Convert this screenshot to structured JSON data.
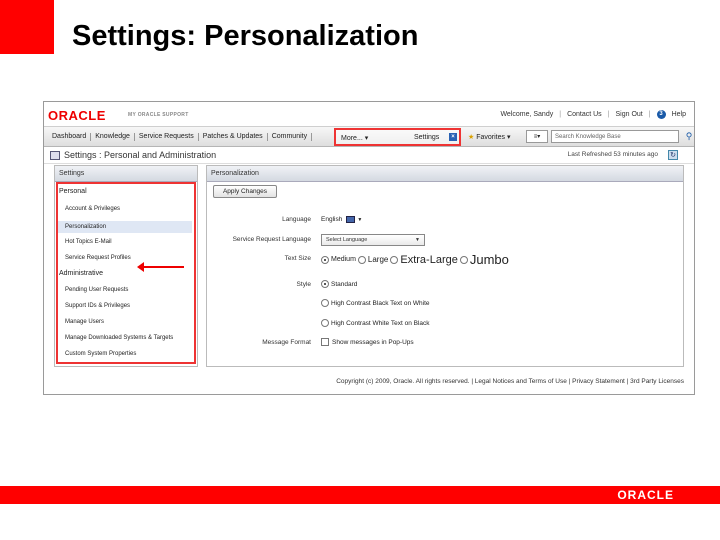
{
  "slide": {
    "title": "Settings: Personalization",
    "footer_logo": "ORACLE"
  },
  "app": {
    "logo": "ORACLE",
    "product": "MY ORACLE SUPPORT",
    "top_links": [
      "Welcome, Sandy",
      "Contact Us",
      "Sign Out",
      "Help"
    ],
    "help_number": "3"
  },
  "nav": {
    "tabs": [
      "Dashboard",
      "Knowledge",
      "Service Requests",
      "Patches & Updates",
      "Community"
    ],
    "more_label": "More...",
    "settings_label": "Settings",
    "favorites_label": "Favorites",
    "search_placeholder": "Search Knowledge Base",
    "colors": {
      "highlight": "#e33333",
      "accent": "#2a62b4"
    }
  },
  "breadcrumb": {
    "text": "Settings : Personal and Administration",
    "last_refreshed": "Last Refreshed 53 minutes ago"
  },
  "left_panel": {
    "header": "Settings",
    "personal_heading": "Personal",
    "personal_items": [
      "Account & Privileges",
      "Personalization",
      "Hot Topics E-Mail",
      "Service Request Profiles"
    ],
    "admin_heading": "Administrative",
    "admin_items": [
      "Pending User Requests",
      "Support IDs & Privileges",
      "Manage Users",
      "Manage Downloaded Systems & Targets",
      "Custom System Properties"
    ],
    "selected_item": "Personalization"
  },
  "right_panel": {
    "header": "Personalization",
    "apply_button": "Apply Changes",
    "language_label": "Language",
    "language_value": "English",
    "sr_language_label": "Service Request Language",
    "sr_language_value": "Select Language",
    "text_size_label": "Text Size",
    "text_sizes": [
      "Medium",
      "Large",
      "Extra-Large",
      "Jumbo"
    ],
    "text_size_selected": "Medium",
    "style_label": "Style",
    "styles": [
      "Standard",
      "High Contrast Black Text on White",
      "High Contrast White Text on Black"
    ],
    "style_selected": "Standard",
    "message_format_label": "Message Format",
    "message_format_option": "Show messages in Pop-Ups"
  },
  "footer": {
    "text": "Copyright (c) 2009, Oracle. All rights reserved. | Legal Notices and Terms of Use | Privacy Statement | 3rd Party Licenses"
  }
}
